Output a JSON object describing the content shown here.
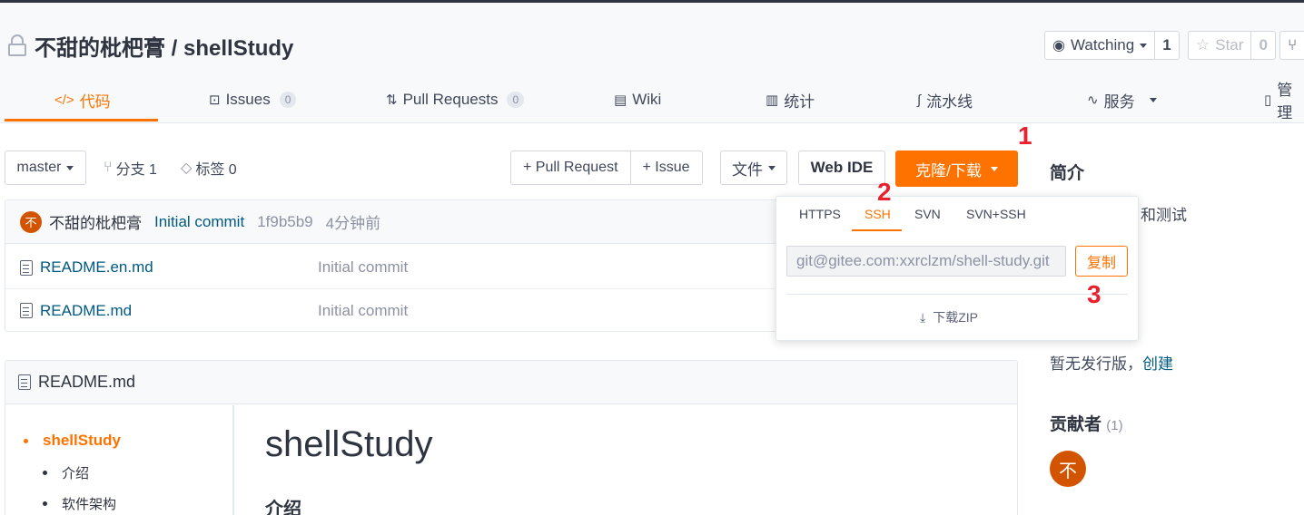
{
  "repo": {
    "title": "不甜的枇杷膏 / shellStudy",
    "watch_label": "Watching",
    "watch_count": "1",
    "star_label": "Star",
    "star_count": "0"
  },
  "tabs": [
    {
      "label": "代码",
      "icon": "code-icon",
      "badge": ""
    },
    {
      "label": "Issues",
      "icon": "issues-icon",
      "badge": "0"
    },
    {
      "label": "Pull Requests",
      "icon": "pull-request-icon",
      "badge": "0"
    },
    {
      "label": "Wiki",
      "icon": "book-icon",
      "badge": ""
    },
    {
      "label": "统计",
      "icon": "bar-chart-icon",
      "badge": ""
    },
    {
      "label": "流水线",
      "icon": "pipeline-icon",
      "badge": ""
    },
    {
      "label": "服务",
      "icon": "pulse-icon",
      "badge": ""
    },
    {
      "label": "管理",
      "icon": "manage-icon",
      "badge": ""
    }
  ],
  "toolbar": {
    "branch": "master",
    "branches": "分支 1",
    "tags": "标签 0",
    "pull_request": "+ Pull Request",
    "issue": "+ Issue",
    "file": "文件",
    "web_ide": "Web IDE",
    "clone": "克隆/下载"
  },
  "annotations": {
    "one": "1",
    "two": "2",
    "three": "3"
  },
  "commit": {
    "avatar": "不",
    "author": "不甜的枇杷膏",
    "message": "Initial commit",
    "sha": "1f9b5b9",
    "time": "4分钟前"
  },
  "files": [
    {
      "name": "README.en.md",
      "message": "Initial commit"
    },
    {
      "name": "README.md",
      "message": "Initial commit"
    }
  ],
  "clone_popup": {
    "tabs": [
      "HTTPS",
      "SSH",
      "SVN",
      "SVN+SSH"
    ],
    "active_tab": "SSH",
    "url": "git@gitee.com:xxrclzm/shell-study.git",
    "copy": "复制",
    "download_zip": "下载ZIP"
  },
  "readme": {
    "file": "README.md",
    "toc": [
      "shellStudy",
      "介绍",
      "软件架构"
    ],
    "h1": "shellStudy",
    "h2": "介绍"
  },
  "sidebar": {
    "intro_heading": "简介",
    "intro_text": "和测试",
    "release_text": "暂无发行版，",
    "release_link": "创建",
    "contributors_heading": "贡献者",
    "contributors_count": "(1)",
    "contributor_avatar": "不"
  },
  "colors": {
    "accent": "#fe7300",
    "link": "#005980",
    "annotation": "#e8212f"
  }
}
